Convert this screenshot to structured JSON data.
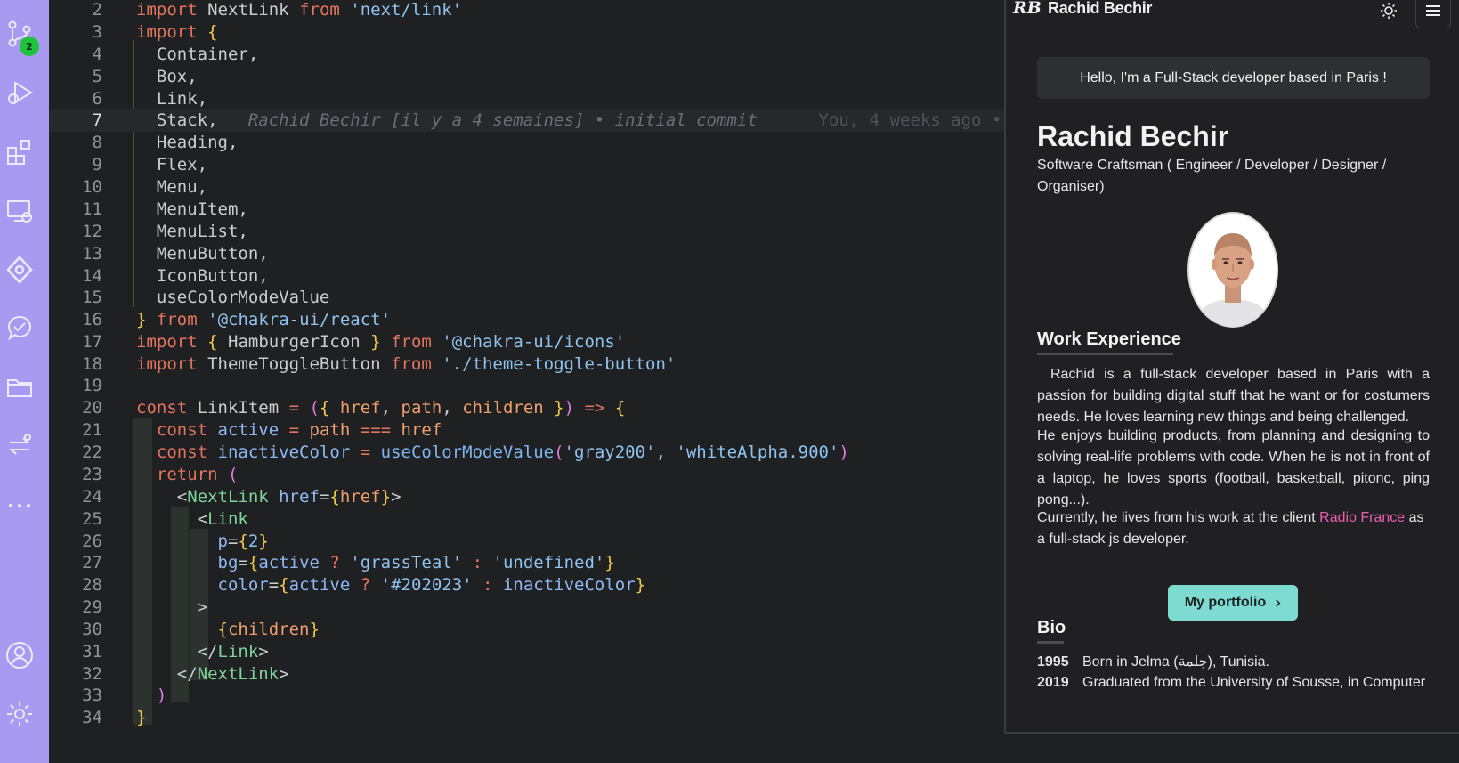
{
  "activity_bar": {
    "items": [
      {
        "icon": "source-control-icon",
        "badge": "2"
      },
      {
        "icon": "run-debug-icon"
      },
      {
        "icon": "extensions-icon"
      },
      {
        "icon": "remote-explorer-icon"
      },
      {
        "icon": "gitlens-icon"
      },
      {
        "icon": "testing-icon"
      },
      {
        "icon": "folder-icon"
      },
      {
        "icon": "sync-icon"
      },
      {
        "icon": "more-icon"
      }
    ],
    "bottom": [
      {
        "icon": "account-icon"
      },
      {
        "icon": "settings-gear-icon"
      }
    ],
    "color": "#a89af0"
  },
  "editor": {
    "lines": [
      {
        "n": "2"
      },
      {
        "n": "3"
      },
      {
        "n": "4"
      },
      {
        "n": "5"
      },
      {
        "n": "6"
      },
      {
        "n": "7",
        "blame": "Rachid Bechir [il y a 4 semaines] • initial commit",
        "blame2": "You, 4 weeks ago •"
      },
      {
        "n": "8"
      },
      {
        "n": "9"
      },
      {
        "n": "10"
      },
      {
        "n": "11"
      },
      {
        "n": "12"
      },
      {
        "n": "13"
      },
      {
        "n": "14"
      },
      {
        "n": "15"
      },
      {
        "n": "16"
      },
      {
        "n": "17"
      },
      {
        "n": "18"
      },
      {
        "n": "19"
      },
      {
        "n": "20"
      },
      {
        "n": "21"
      },
      {
        "n": "22"
      },
      {
        "n": "23"
      },
      {
        "n": "24"
      },
      {
        "n": "25"
      },
      {
        "n": "26"
      },
      {
        "n": "27"
      },
      {
        "n": "28"
      },
      {
        "n": "29"
      },
      {
        "n": "30"
      },
      {
        "n": "31"
      },
      {
        "n": "32"
      },
      {
        "n": "33"
      },
      {
        "n": "34"
      }
    ],
    "tokens": {
      "import": "import",
      "from": "from",
      "const": "const",
      "return": "return",
      "NextLink": "NextLink",
      "next_link": "'next/link'",
      "Container": "Container,",
      "Box": "Box,",
      "Link": "Link,",
      "Stack": "Stack,",
      "Heading": "Heading,",
      "Flex": "Flex,",
      "Menu": "Menu,",
      "MenuItem": "MenuItem,",
      "MenuList": "MenuList,",
      "MenuButton": "MenuButton,",
      "IconButton": "IconButton,",
      "useColorModeValue": "useColorModeValue",
      "chakra_react": "'@chakra-ui/react'",
      "HamburgerIcon": "HamburgerIcon",
      "chakra_icons": "'@chakra-ui/icons'",
      "ThemeToggleButton": "ThemeToggleButton",
      "theme_path": "'./theme-toggle-button'",
      "LinkItem": "LinkItem",
      "href": "href",
      "path": "path",
      "children": "children",
      "active": "active",
      "inactiveColor": "inactiveColor",
      "gray200": "'gray200'",
      "whiteAlpha": "'whiteAlpha.900'",
      "LinkTag": "Link",
      "p": "p",
      "two": "2",
      "bg": "bg",
      "grassTeal": "'grassTeal'",
      "undefined": "'undefined'",
      "color": "color",
      "hex": "'#202023'"
    }
  },
  "preview": {
    "logo": "RB",
    "brand": "Rachid Bechir",
    "hello": "Hello, I'm a Full-Stack developer based in Paris !",
    "name": "Rachid Bechir",
    "subtitle": "Software Craftsman ( Engineer / Developer / Designer / Organiser)",
    "work_title": "Work Experience",
    "work_p1": "Rachid is a full-stack developer based in Paris with a passion for building digital stuff that he want or for costumers needs. He loves learning new things and being challenged.",
    "work_p2": "He enjoys building products, from planning and designing to solving real-life problems with code. When he is not in front of a laptop, he loves sports (football, basketball, pitonc, ping pong...).",
    "work_p3_a": "Currently, he lives from his work at the client ",
    "work_p3_link": "Radio France",
    "work_p3_b": " as a full-stack js developer.",
    "portfolio_label": "My portfolio",
    "bio_title": "Bio",
    "bio": [
      {
        "year": "1995",
        "text": "Born in Jelma (جلمة), Tunisia."
      },
      {
        "year": "2019",
        "text": "Graduated from the University of Sousse, in Computer"
      }
    ],
    "accent": "#7ddbd1",
    "link_color": "#ec5fb0"
  }
}
